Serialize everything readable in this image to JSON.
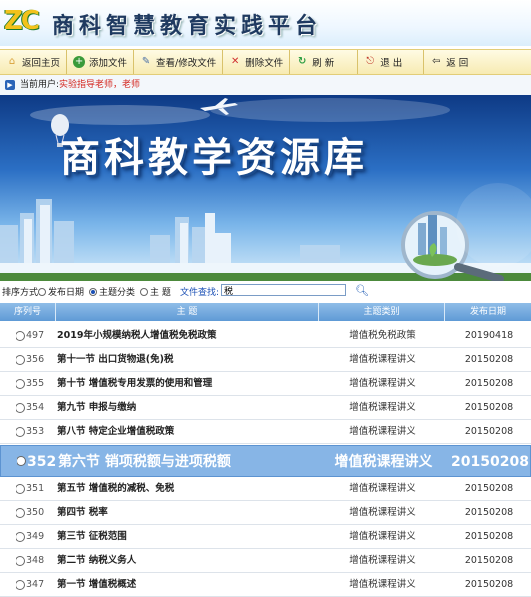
{
  "header": {
    "logo": "ZC",
    "title": "商科智慧教育实践平台"
  },
  "toolbar": [
    {
      "label": "返回主页",
      "icon": "home-icon",
      "color": "#d9a13a"
    },
    {
      "label": "添加文件",
      "icon": "add-icon",
      "color": "#3a9a3a"
    },
    {
      "label": "查看/修改文件",
      "icon": "edit-icon",
      "color": "#4a6fa5"
    },
    {
      "label": "删除文件",
      "icon": "delete-icon",
      "color": "#d03030"
    },
    {
      "label": "刷 新",
      "icon": "refresh-icon",
      "color": "#2e9e44"
    },
    {
      "label": "退 出",
      "icon": "exit-icon",
      "color": "#c0392b"
    },
    {
      "label": "返 回",
      "icon": "back-icon",
      "color": "#333333"
    }
  ],
  "user_bar": {
    "label": "当前用户:",
    "user": "实验指导老师，老师"
  },
  "banner": {
    "title": "商科教学资源库"
  },
  "sort": {
    "label": "排序方式:",
    "options": [
      "发布日期",
      "主题分类",
      "主 题"
    ],
    "selected": 1,
    "search_label": "文件查找:",
    "search_value": "税"
  },
  "table": {
    "headers": [
      "序列号",
      "主 题",
      "主题类别",
      "发布日期"
    ],
    "rows": [
      [
        "497",
        "2019年小规模纳税人增值税免税政策",
        "增值税免税政策",
        "20190418"
      ],
      [
        "356",
        "第十一节 出口货物退(免)税",
        "增值税课程讲义",
        "20150208"
      ],
      [
        "355",
        "第十节 增值税专用发票的使用和管理",
        "增值税课程讲义",
        "20150208"
      ],
      [
        "354",
        "第九节 申报与缴纳",
        "增值税课程讲义",
        "20150208"
      ],
      [
        "353",
        "第八节 特定企业增值税政策",
        "增值税课程讲义",
        "20150208"
      ],
      [
        "352",
        "第六节 销项税额与进项税额",
        "增值税课程讲义",
        "20150208"
      ],
      [
        "351",
        "第五节 增值税的减税、免税",
        "增值税课程讲义",
        "20150208"
      ],
      [
        "350",
        "第四节 税率",
        "增值税课程讲义",
        "20150208"
      ],
      [
        "349",
        "第三节 征税范围",
        "增值税课程讲义",
        "20150208"
      ],
      [
        "348",
        "第二节 纳税义务人",
        "增值税课程讲义",
        "20150208"
      ],
      [
        "347",
        "第一节 增值税概述",
        "增值税课程讲义",
        "20150208"
      ]
    ],
    "highlighted_row": 5
  },
  "colors": {
    "accent": "#5f9ad6",
    "highlight": "#87b5e6",
    "user": "#d4261f"
  }
}
